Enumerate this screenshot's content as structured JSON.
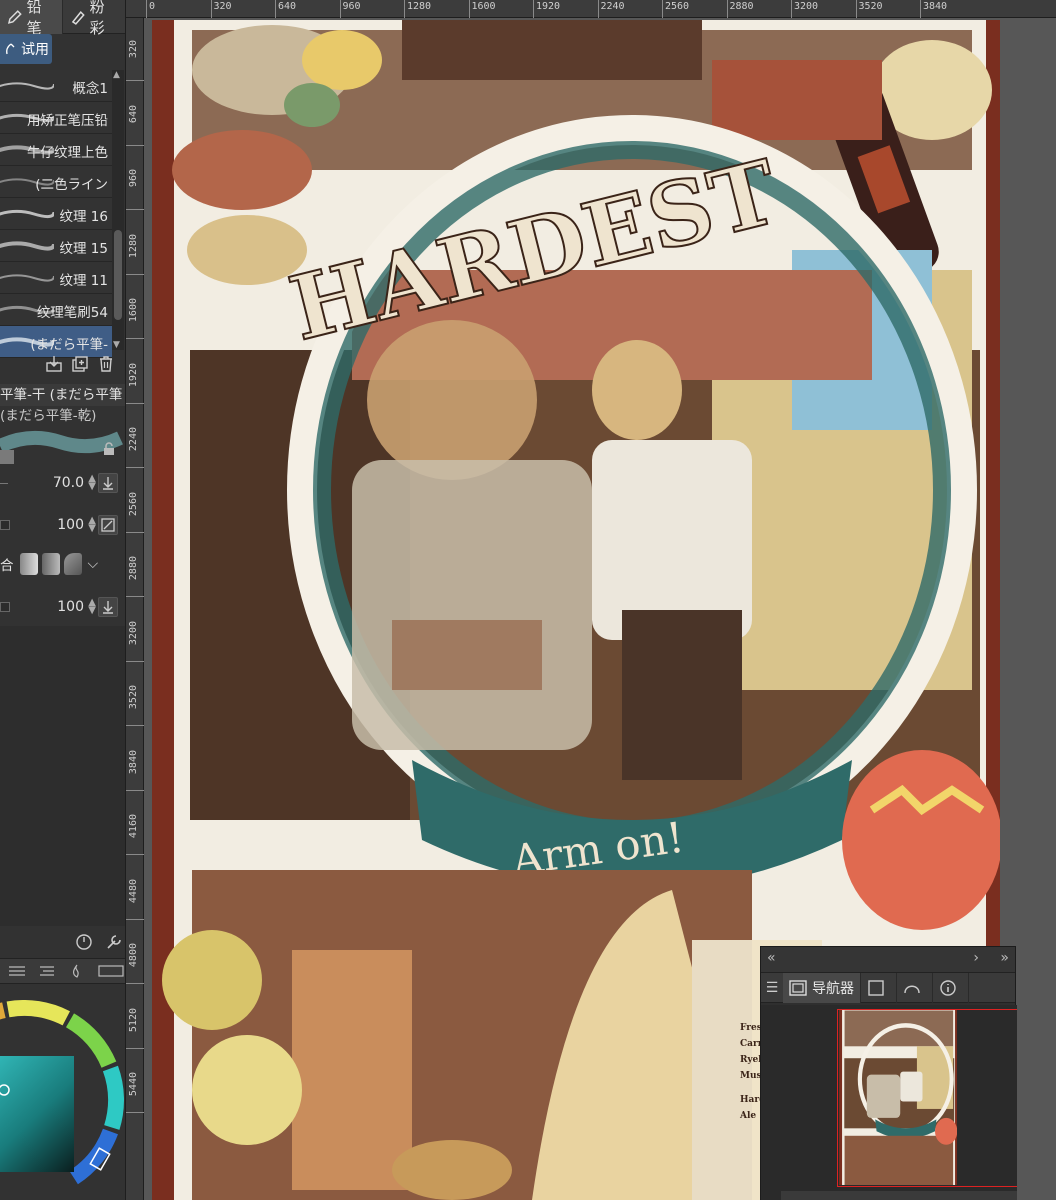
{
  "toolbar": {
    "tabs": [
      {
        "label": "铅笔",
        "icon": "pencil-icon",
        "active": true
      },
      {
        "label": "粉彩",
        "icon": "pastel-icon",
        "active": false
      }
    ],
    "subtab": {
      "label": "试用",
      "icon": "hand-icon"
    }
  },
  "brushes": [
    {
      "label": "概念1",
      "selected": false
    },
    {
      "label": "用矫正笔压铅",
      "selected": false
    },
    {
      "label": "牛仔纹理上色",
      "selected": false
    },
    {
      "label": "(二色ライン",
      "selected": false
    },
    {
      "label": "纹理 16",
      "selected": false
    },
    {
      "label": "纹理 15",
      "selected": false
    },
    {
      "label": "纹理 11",
      "selected": false
    },
    {
      "label": "纹理笔刷54",
      "selected": false
    },
    {
      "label": "(まだら平筆-",
      "selected": true
    }
  ],
  "tool_property": {
    "title": "平筆-干 (まだら平筆",
    "subtitle": "(まだら平筆-乾)",
    "size": {
      "value": "70.0"
    },
    "opacity": {
      "value": "100"
    },
    "blend_label": "合",
    "density": {
      "value": "100"
    }
  },
  "rulers": {
    "top_labels": [
      "0",
      "320",
      "640",
      "960",
      "1280",
      "1600",
      "1920",
      "2240",
      "2560",
      "2880",
      "3200",
      "3520",
      "3840"
    ],
    "left_labels": [
      "320",
      "640",
      "960",
      "1280",
      "1600",
      "1920",
      "2240",
      "2560",
      "2880",
      "3200",
      "3520",
      "3840",
      "4160",
      "4480",
      "4800",
      "5120",
      "5440"
    ]
  },
  "artwork": {
    "title_text": "HARDEST",
    "banner_text": "Arm on!",
    "menu_lines": [
      "Fresh",
      "Carr",
      "Ryeb",
      "Mush",
      "Hard",
      "Ale"
    ]
  },
  "navigator": {
    "tab_label": "导航器",
    "tab_icon": "navigator-icon"
  },
  "colors": {
    "accent": "#3f5d86",
    "panel": "#323232",
    "canvas_bg": "#575757",
    "artwork_border": "#7a2e1f"
  }
}
